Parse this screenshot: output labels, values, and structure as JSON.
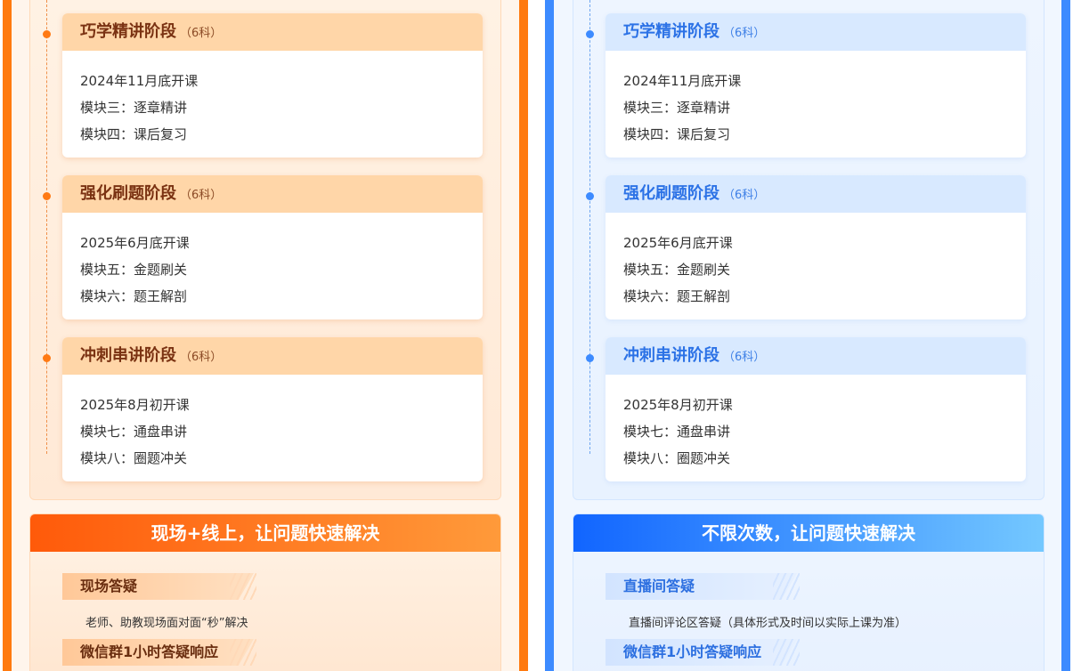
{
  "left": {
    "stages": [
      {
        "title": "巧学精讲阶段",
        "count": "（6科）",
        "lines": [
          "2024年11月底开课",
          "模块三：逐章精讲",
          "模块四：课后复习"
        ]
      },
      {
        "title": "强化刷题阶段",
        "count": "（6科）",
        "lines": [
          "2025年6月底开课",
          "模块五：金题刷关",
          "模块六：题王解剖"
        ]
      },
      {
        "title": "冲刺串讲阶段",
        "count": "（6科）",
        "lines": [
          "2025年8月初开课",
          "模块七：通盘串讲",
          "模块八：圈题冲关"
        ]
      }
    ],
    "qa": {
      "title": "现场+线上，让问题快速解决",
      "items": [
        {
          "tag": "现场答疑",
          "desc": "老师、助教现场面对面“秒”解决"
        },
        {
          "tag": "微信群1小时答疑响应",
          "desc": ""
        }
      ]
    }
  },
  "right": {
    "stages": [
      {
        "title": "巧学精讲阶段",
        "count": "（6科）",
        "lines": [
          "2024年11月底开课",
          "模块三：逐章精讲",
          "模块四：课后复习"
        ]
      },
      {
        "title": "强化刷题阶段",
        "count": "（6科）",
        "lines": [
          "2025年6月底开课",
          "模块五：金题刷关",
          "模块六：题王解剖"
        ]
      },
      {
        "title": "冲刺串讲阶段",
        "count": "（6科）",
        "lines": [
          "2025年8月初开课",
          "模块七：通盘串讲",
          "模块八：圈题冲关"
        ]
      }
    ],
    "qa": {
      "title": "不限次数，让问题快速解决",
      "items": [
        {
          "tag": "直播间答疑",
          "desc": "直播间评论区答疑（具体形式及时间以实际上课为准）"
        },
        {
          "tag": "微信群1小时答疑响应",
          "desc": ""
        }
      ]
    }
  },
  "colors": {
    "orange": "#ff7a0f",
    "blue": "#3d8bff"
  }
}
